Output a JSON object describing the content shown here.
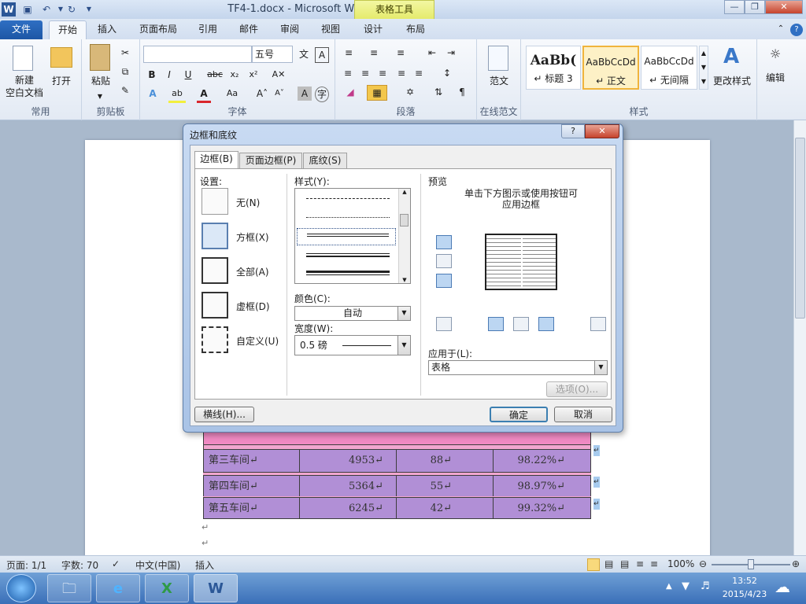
{
  "window": {
    "title": "TF4-1.docx - Microsoft Word",
    "table_tools": "表格工具"
  },
  "tabs": [
    "文件",
    "开始",
    "插入",
    "页面布局",
    "引用",
    "邮件",
    "审阅",
    "视图",
    "设计",
    "布局"
  ],
  "ribbon": {
    "common": {
      "new_doc": "新建\n空白文档",
      "open": "打开",
      "group": "常用"
    },
    "clipboard": {
      "paste": "粘贴",
      "group": "剪贴板"
    },
    "font": {
      "font_name": "",
      "font_size": "五号",
      "group": "字体"
    },
    "paragraph": {
      "group": "段落"
    },
    "online": {
      "template": "范文",
      "group": "在线范文"
    },
    "styles": {
      "items": [
        {
          "preview": "AaBb(",
          "name": "↵ 标题 3"
        },
        {
          "preview": "AaBbCcDd",
          "name": "↵ 正文"
        },
        {
          "preview": "AaBbCcDd",
          "name": "↵ 无间隔"
        }
      ],
      "change": "更改样式",
      "group": "样式"
    },
    "edit": "编辑"
  },
  "table": {
    "rows": [
      {
        "name": "第三车间↵",
        "a": "4953↵",
        "b": "88↵",
        "c": "98.22%↵"
      },
      {
        "name": "第四车间↵",
        "a": "5364↵",
        "b": "55↵",
        "c": "98.97%↵"
      },
      {
        "name": "第五车间↵",
        "a": "6245↵",
        "b": "42↵",
        "c": "99.32%↵"
      }
    ]
  },
  "dialog": {
    "title": "边框和底纹",
    "tabs": [
      "边框(B)",
      "页面边框(P)",
      "底纹(S)"
    ],
    "settings_label": "设置:",
    "settings": [
      "无(N)",
      "方框(X)",
      "全部(A)",
      "虚框(D)",
      "自定义(U)"
    ],
    "style_label": "样式(Y):",
    "color_label": "颜色(C):",
    "color_value": "自动",
    "width_label": "宽度(W):",
    "width_value": "0.5 磅",
    "preview_label": "预览",
    "preview_hint": "单击下方图示或使用按钮可\n应用边框",
    "apply_label": "应用于(L):",
    "apply_value": "表格",
    "options_btn": "选项(O)...",
    "hline_btn": "横线(H)...",
    "ok_btn": "确定",
    "cancel_btn": "取消"
  },
  "status": {
    "page": "页面: 1/1",
    "words": "字数: 70",
    "lang": "中文(中国)",
    "mode": "插入",
    "zoom": "100%"
  },
  "clock": {
    "time": "13:52",
    "date": "2015/4/23"
  }
}
